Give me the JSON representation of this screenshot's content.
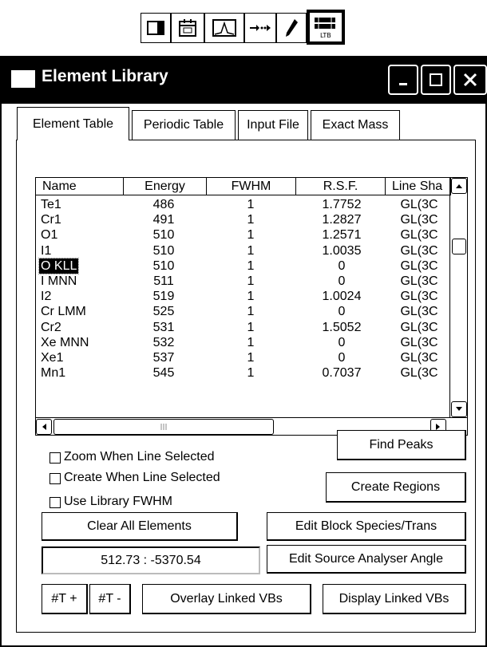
{
  "toolbar": {
    "icons": [
      "panel-icon",
      "calendar-icon",
      "peak-icon",
      "arrow-dots-icon",
      "pencil-icon",
      "element-library-icon"
    ],
    "library_icon_text": "LTB"
  },
  "window": {
    "title": "Element Library"
  },
  "tabs": [
    "Element Table",
    "Periodic Table",
    "Input File",
    "Exact Mass"
  ],
  "table": {
    "columns": [
      "Name",
      "Energy",
      "FWHM",
      "R.S.F.",
      "Line Sha"
    ],
    "rows": [
      {
        "name": "Te1",
        "energy": "486",
        "fwhm": "1",
        "rsf": "1.7752",
        "line": "GL(3C"
      },
      {
        "name": "Cr1",
        "energy": "491",
        "fwhm": "1",
        "rsf": "1.2827",
        "line": "GL(3C"
      },
      {
        "name": "O1",
        "energy": "510",
        "fwhm": "1",
        "rsf": "1.2571",
        "line": "GL(3C"
      },
      {
        "name": "I1",
        "energy": "510",
        "fwhm": "1",
        "rsf": "1.0035",
        "line": "GL(3C"
      },
      {
        "name": "O KLL",
        "energy": "510",
        "fwhm": "1",
        "rsf": "0",
        "line": "GL(3C"
      },
      {
        "name": "I MNN",
        "energy": "511",
        "fwhm": "1",
        "rsf": "0",
        "line": "GL(3C"
      },
      {
        "name": "I2",
        "energy": "519",
        "fwhm": "1",
        "rsf": "1.0024",
        "line": "GL(3C"
      },
      {
        "name": "Cr LMM",
        "energy": "525",
        "fwhm": "1",
        "rsf": "0",
        "line": "GL(3C"
      },
      {
        "name": "Cr2",
        "energy": "531",
        "fwhm": "1",
        "rsf": "1.5052",
        "line": "GL(3C"
      },
      {
        "name": "Xe MNN",
        "energy": "532",
        "fwhm": "1",
        "rsf": "0",
        "line": "GL(3C"
      },
      {
        "name": "Xe1",
        "energy": "537",
        "fwhm": "1",
        "rsf": "0",
        "line": "GL(3C"
      },
      {
        "name": "Mn1",
        "energy": "545",
        "fwhm": "1",
        "rsf": "0.7037",
        "line": "GL(3C"
      }
    ],
    "selected_index": 4
  },
  "options": {
    "zoom_label": "Zoom When Line Selected",
    "create_label": "Create When Line Selected",
    "fwhm_label": "Use Library FWHM"
  },
  "buttons": {
    "find_peaks": "Find Peaks",
    "create_regions": "Create Regions",
    "clear_all": "Clear All Elements",
    "edit_block": "Edit Block Species/Trans",
    "edit_source": "Edit Source Analyser Angle",
    "t_plus": "#T +",
    "t_minus": "#T -",
    "overlay": "Overlay Linked VBs",
    "display": "Display Linked VBs"
  },
  "readout": "512.73 : -5370.54"
}
